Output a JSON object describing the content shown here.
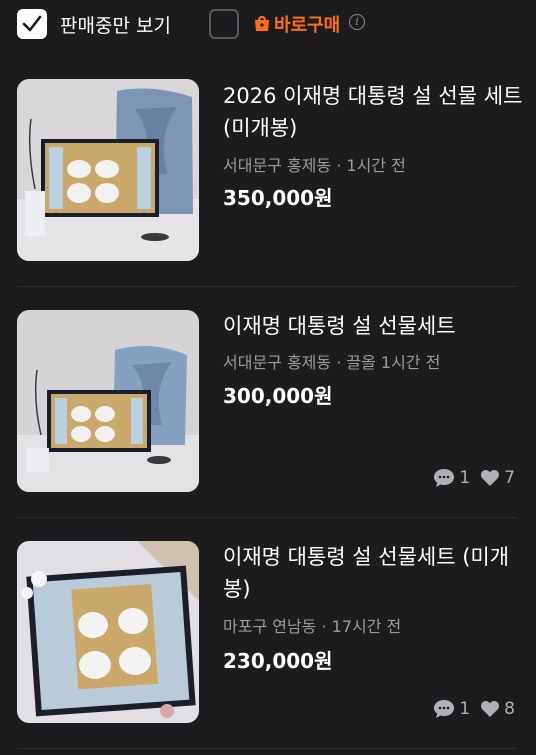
{
  "filters": {
    "on_sale_only": {
      "label": "판매중만 보기",
      "checked": true
    },
    "direct_purchase": {
      "label": "바로구매",
      "checked": false,
      "accent": "#ff6f0f"
    }
  },
  "listings": [
    {
      "title": "2026 이재명 대통령 설 선물 세트 (미개봉)",
      "location": "서대문구 홍제동",
      "time": "1시간 전",
      "meta": "서대문구 홍제동 · 1시간 전",
      "price": "350,000원"
    },
    {
      "title": "이재명 대통령 설 선물세트",
      "location": "서대문구 홍제동",
      "time": "끌올 1시간 전",
      "meta": "서대문구 홍제동 · 끌올 1시간 전",
      "price": "300,000원",
      "chats": "1",
      "likes": "7"
    },
    {
      "title": "이재명 대통령 설 선물세트 (미개봉)",
      "location": "마포구 연남동",
      "time": "17시간 전",
      "meta": "마포구 연남동 · 17시간 전",
      "price": "230,000원",
      "chats": "1",
      "likes": "8"
    }
  ],
  "icons": {
    "checkbox_checked": "check-icon",
    "brand": "carrot-bag-icon",
    "info": "info-icon",
    "chat": "chat-bubble-icon",
    "like": "heart-icon"
  }
}
